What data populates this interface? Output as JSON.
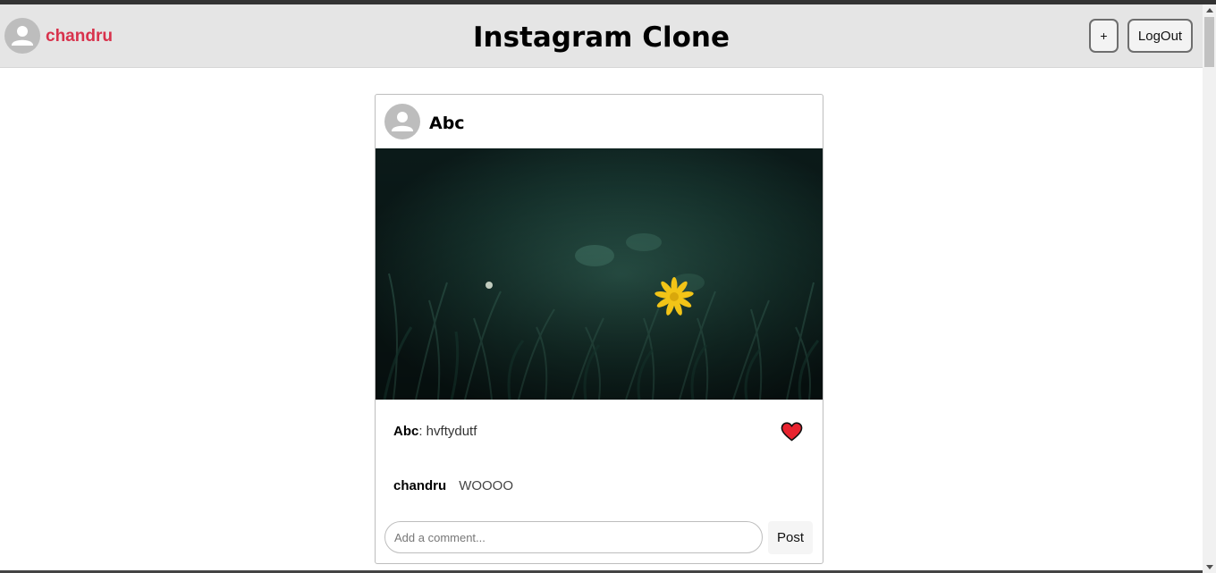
{
  "header": {
    "username": "chandru",
    "title": "Instagram Clone",
    "add_label": "+",
    "logout_label": "LogOut"
  },
  "post": {
    "author": "Abc",
    "image_alt": "green grass with a yellow flower",
    "caption_author": "Abc",
    "caption_text": ": hvftydutf",
    "liked": true,
    "comments": [
      {
        "user": "chandru",
        "text": "WOOOO"
      }
    ],
    "comment_placeholder": "Add a comment...",
    "post_label": "Post"
  },
  "colors": {
    "header_bg": "#e5e5e5",
    "username": "#d8324c",
    "heart": "#e8232f"
  }
}
